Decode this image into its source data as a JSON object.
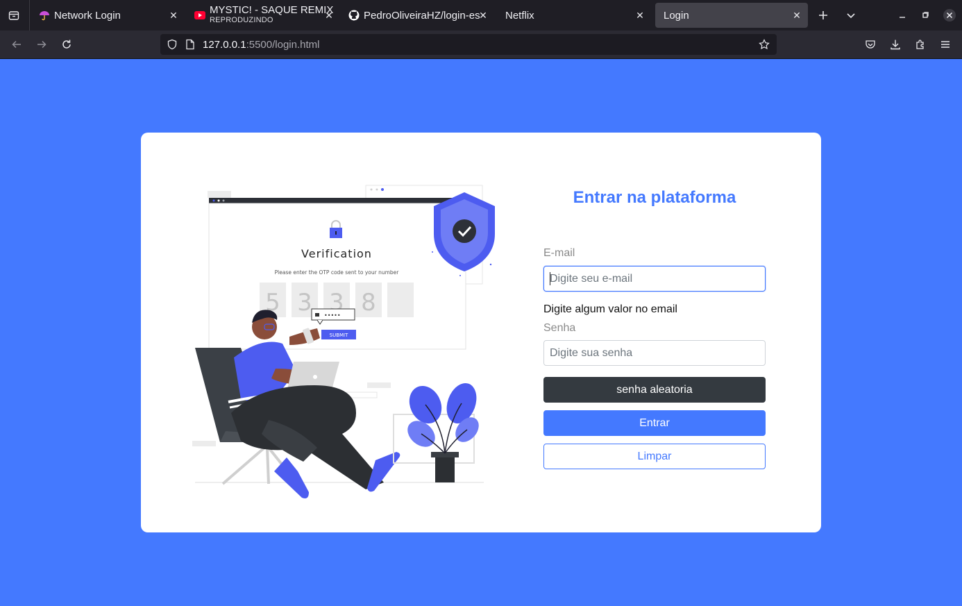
{
  "browser": {
    "tabs": [
      {
        "title": "Network Login",
        "subtitle": "",
        "active": false
      },
      {
        "title": "MYSTIC! - SAQUE REMIX",
        "subtitle": "REPRODUZINDO",
        "active": false
      },
      {
        "title": "PedroOliveiraHZ/login-es",
        "subtitle": "",
        "active": false
      },
      {
        "title": "Netflix",
        "subtitle": "",
        "active": false
      },
      {
        "title": "Login",
        "subtitle": "",
        "active": true
      }
    ],
    "url_host": "127.0.0.1",
    "url_rest": ":5500/login.html"
  },
  "illustration": {
    "heading": "Verification",
    "caption": "Please enter the OTP code sent to your number",
    "otp_digits": [
      "5",
      "3",
      "3",
      "8",
      ""
    ],
    "submit_label": "SUBMIT",
    "password_mask": "•••••"
  },
  "form": {
    "title": "Entrar na plataforma",
    "email_label": "E-mail",
    "email_placeholder": "Digite seu e-mail",
    "email_value": "",
    "email_error": "Digite algum valor no email",
    "password_label": "Senha",
    "password_placeholder": "Digite sua senha",
    "password_value": "",
    "random_password_button": "senha aleatoria",
    "submit_button": "Entrar",
    "clear_button": "Limpar"
  },
  "colors": {
    "page_background": "#4479ff",
    "accent": "#4479ff",
    "dark_button": "#343a40"
  }
}
